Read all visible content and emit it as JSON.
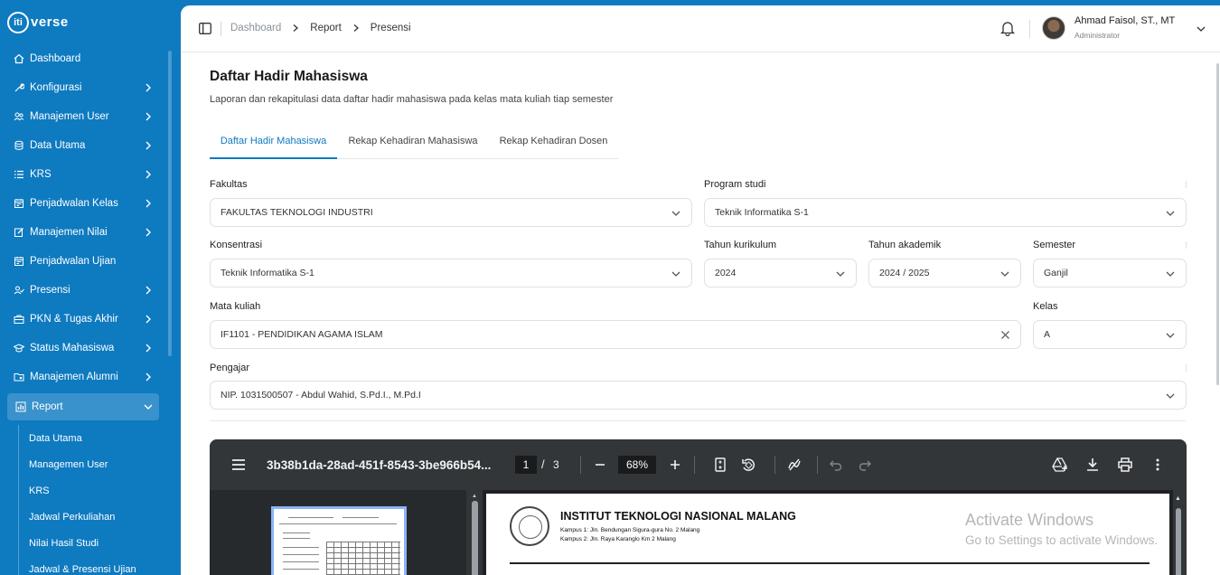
{
  "app": {
    "logo_mark": "iti",
    "logo_word": "verse"
  },
  "sidebar": {
    "items": [
      {
        "label": "Dashboard",
        "icon": "home-icon"
      },
      {
        "label": "Konfigurasi",
        "icon": "wrench-icon"
      },
      {
        "label": "Manajemen User",
        "icon": "users-icon"
      },
      {
        "label": "Data Utama",
        "icon": "database-icon"
      },
      {
        "label": "KRS",
        "icon": "list-icon"
      },
      {
        "label": "Penjadwalan Kelas",
        "icon": "calendar-icon"
      },
      {
        "label": "Manajemen Nilai",
        "icon": "edit-icon"
      },
      {
        "label": "Penjadwalan Ujian",
        "icon": "calendar-icon"
      },
      {
        "label": "Presensi",
        "icon": "user-check-icon"
      },
      {
        "label": "PKN & Tugas Akhir",
        "icon": "briefcase-icon"
      },
      {
        "label": "Status Mahasiswa",
        "icon": "graduation-cap-icon"
      },
      {
        "label": "Manajemen Alumni",
        "icon": "folder-user-icon"
      },
      {
        "label": "Report",
        "icon": "report-icon"
      }
    ],
    "report_submenu": [
      "Data Utama",
      "Managemen User",
      "KRS",
      "Jadwal Perkuliahan",
      "Nilai Hasil Studi",
      "Jadwal & Presensi Ujian"
    ]
  },
  "breadcrumb": [
    "Dashboard",
    "Report",
    "Presensi"
  ],
  "user": {
    "name": "Ahmad Faisol, ST., MT",
    "role": "Administrator"
  },
  "page": {
    "title": "Daftar Hadir Mahasiswa",
    "description": "Laporan dan rekapitulasi data daftar hadir mahasiswa pada kelas mata kuliah tiap semester"
  },
  "tabs": [
    "Daftar Hadir Mahasiswa",
    "Rekap Kehadiran Mahasiswa",
    "Rekap Kehadiran Dosen"
  ],
  "form": {
    "fakultas": {
      "label": "Fakultas",
      "value": "FAKULTAS TEKNOLOGI INDUSTRI"
    },
    "prodi": {
      "label": "Program studi",
      "value": "Teknik Informatika S-1"
    },
    "konsentrasi": {
      "label": "Konsentrasi",
      "value": "Teknik Informatika S-1"
    },
    "kurikulum": {
      "label": "Tahun kurikulum",
      "value": "2024"
    },
    "akademik": {
      "label": "Tahun akademik",
      "value": "2024 / 2025"
    },
    "semester": {
      "label": "Semester",
      "value": "Ganjil"
    },
    "matkul": {
      "label": "Mata kuliah",
      "value": "IF1101 - PENDIDIKAN AGAMA ISLAM"
    },
    "kelas": {
      "label": "Kelas",
      "value": "A"
    },
    "pengajar": {
      "label": "Pengajar",
      "value": "NIP. 1031500507 - Abdul Wahid, S.Pd.I., M.Pd.I"
    }
  },
  "pdf": {
    "filename": "3b38b1da-28ad-451f-8543-3be966b54...",
    "page": "1",
    "slash": "/",
    "total": "3",
    "zoom": "68%",
    "doc_title": "INSTITUT TEKNOLOGI NASIONAL MALANG",
    "doc_addr1": "Kampus 1: Jln. Bendungan Sigura-gura No. 2 Malang",
    "doc_addr2": "Kampus 2: Jln. Raya Karanglo Km 2 Malang"
  },
  "watermark": {
    "line1": "Activate Windows",
    "line2": "Go to Settings to activate Windows."
  },
  "colors": {
    "brand": "#0e7ac0",
    "pdf_toolbar": "#323639"
  }
}
